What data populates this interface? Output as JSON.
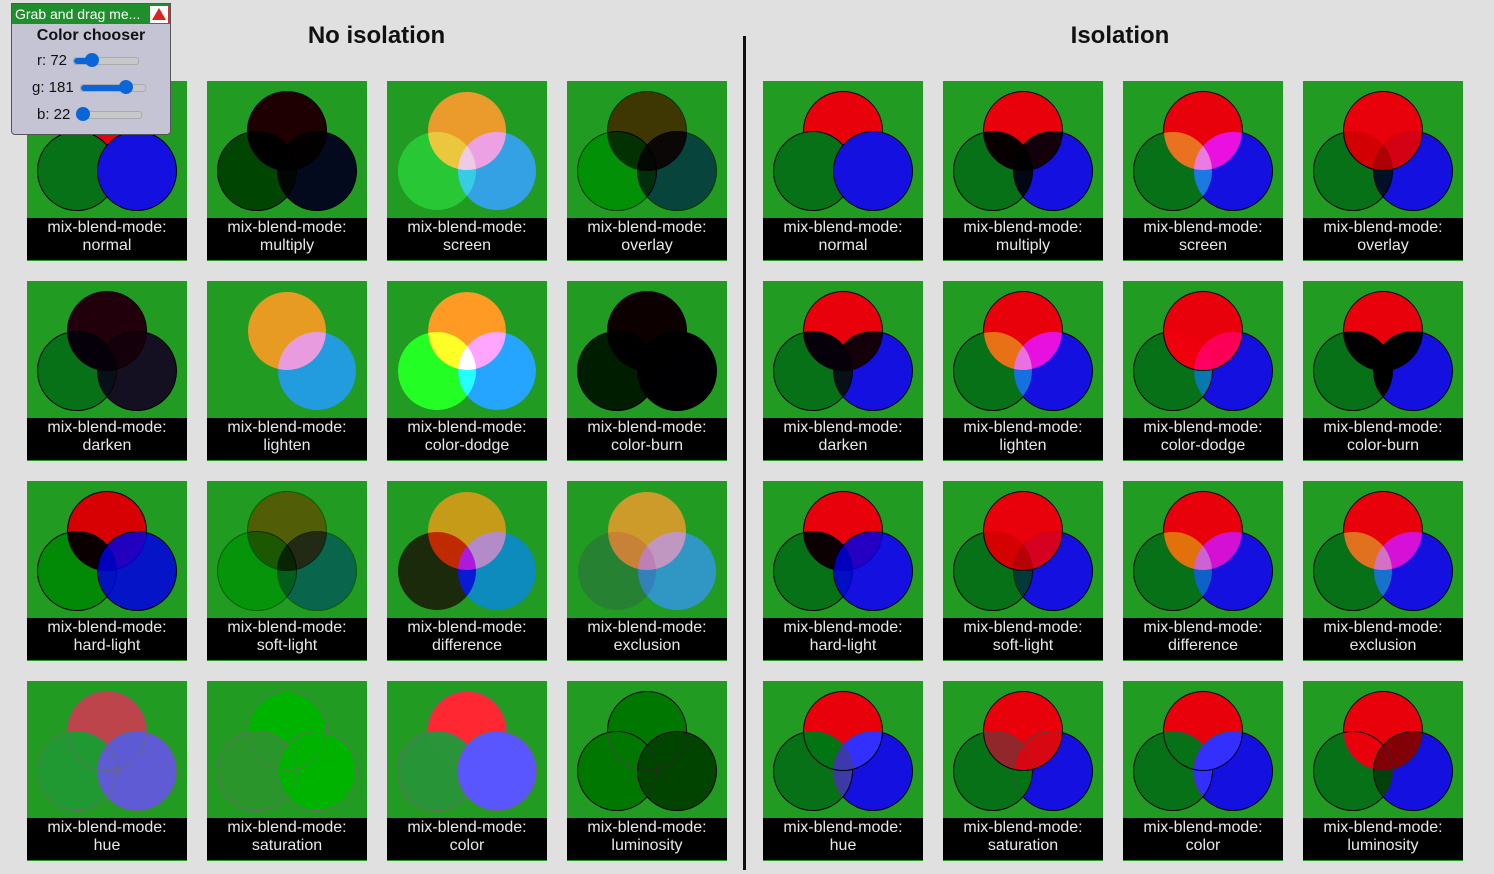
{
  "colors": {
    "background": "#e0e0e0",
    "tile": "#229b22",
    "red": "#e8000b",
    "green": "#067116",
    "blue": "#1410df"
  },
  "sections": [
    {
      "title": "No isolation",
      "isolated": false,
      "tiles": [
        {
          "prefix": "mix-blend-mode:",
          "mode": "normal"
        },
        {
          "prefix": "mix-blend-mode:",
          "mode": "multiply"
        },
        {
          "prefix": "mix-blend-mode:",
          "mode": "screen"
        },
        {
          "prefix": "mix-blend-mode:",
          "mode": "overlay"
        },
        {
          "prefix": "mix-blend-mode:",
          "mode": "darken"
        },
        {
          "prefix": "mix-blend-mode:",
          "mode": "lighten"
        },
        {
          "prefix": "mix-blend-mode:",
          "mode": "color-dodge"
        },
        {
          "prefix": "mix-blend-mode:",
          "mode": "color-burn"
        },
        {
          "prefix": "mix-blend-mode:",
          "mode": "hard-light"
        },
        {
          "prefix": "mix-blend-mode:",
          "mode": "soft-light"
        },
        {
          "prefix": "mix-blend-mode:",
          "mode": "difference"
        },
        {
          "prefix": "mix-blend-mode:",
          "mode": "exclusion"
        },
        {
          "prefix": "mix-blend-mode:",
          "mode": "hue"
        },
        {
          "prefix": "mix-blend-mode:",
          "mode": "saturation"
        },
        {
          "prefix": "mix-blend-mode:",
          "mode": "color"
        },
        {
          "prefix": "mix-blend-mode:",
          "mode": "luminosity"
        }
      ]
    },
    {
      "title": "Isolation",
      "isolated": true,
      "tiles": [
        {
          "prefix": "mix-blend-mode:",
          "mode": "normal"
        },
        {
          "prefix": "mix-blend-mode:",
          "mode": "multiply"
        },
        {
          "prefix": "mix-blend-mode:",
          "mode": "screen"
        },
        {
          "prefix": "mix-blend-mode:",
          "mode": "overlay"
        },
        {
          "prefix": "mix-blend-mode:",
          "mode": "darken"
        },
        {
          "prefix": "mix-blend-mode:",
          "mode": "lighten"
        },
        {
          "prefix": "mix-blend-mode:",
          "mode": "color-dodge"
        },
        {
          "prefix": "mix-blend-mode:",
          "mode": "color-burn"
        },
        {
          "prefix": "mix-blend-mode:",
          "mode": "hard-light"
        },
        {
          "prefix": "mix-blend-mode:",
          "mode": "soft-light"
        },
        {
          "prefix": "mix-blend-mode:",
          "mode": "difference"
        },
        {
          "prefix": "mix-blend-mode:",
          "mode": "exclusion"
        },
        {
          "prefix": "mix-blend-mode:",
          "mode": "hue"
        },
        {
          "prefix": "mix-blend-mode:",
          "mode": "saturation"
        },
        {
          "prefix": "mix-blend-mode:",
          "mode": "color"
        },
        {
          "prefix": "mix-blend-mode:",
          "mode": "luminosity"
        }
      ]
    }
  ],
  "chooser": {
    "drag_label": "Grab and drag me...",
    "close_icon": "close-triangle-icon",
    "title": "Color chooser",
    "sliders": [
      {
        "label": "r: 72",
        "value": 72,
        "max": 255
      },
      {
        "label": "g: 181",
        "value": 181,
        "max": 255
      },
      {
        "label": "b: 22",
        "value": 22,
        "max": 255
      }
    ]
  }
}
